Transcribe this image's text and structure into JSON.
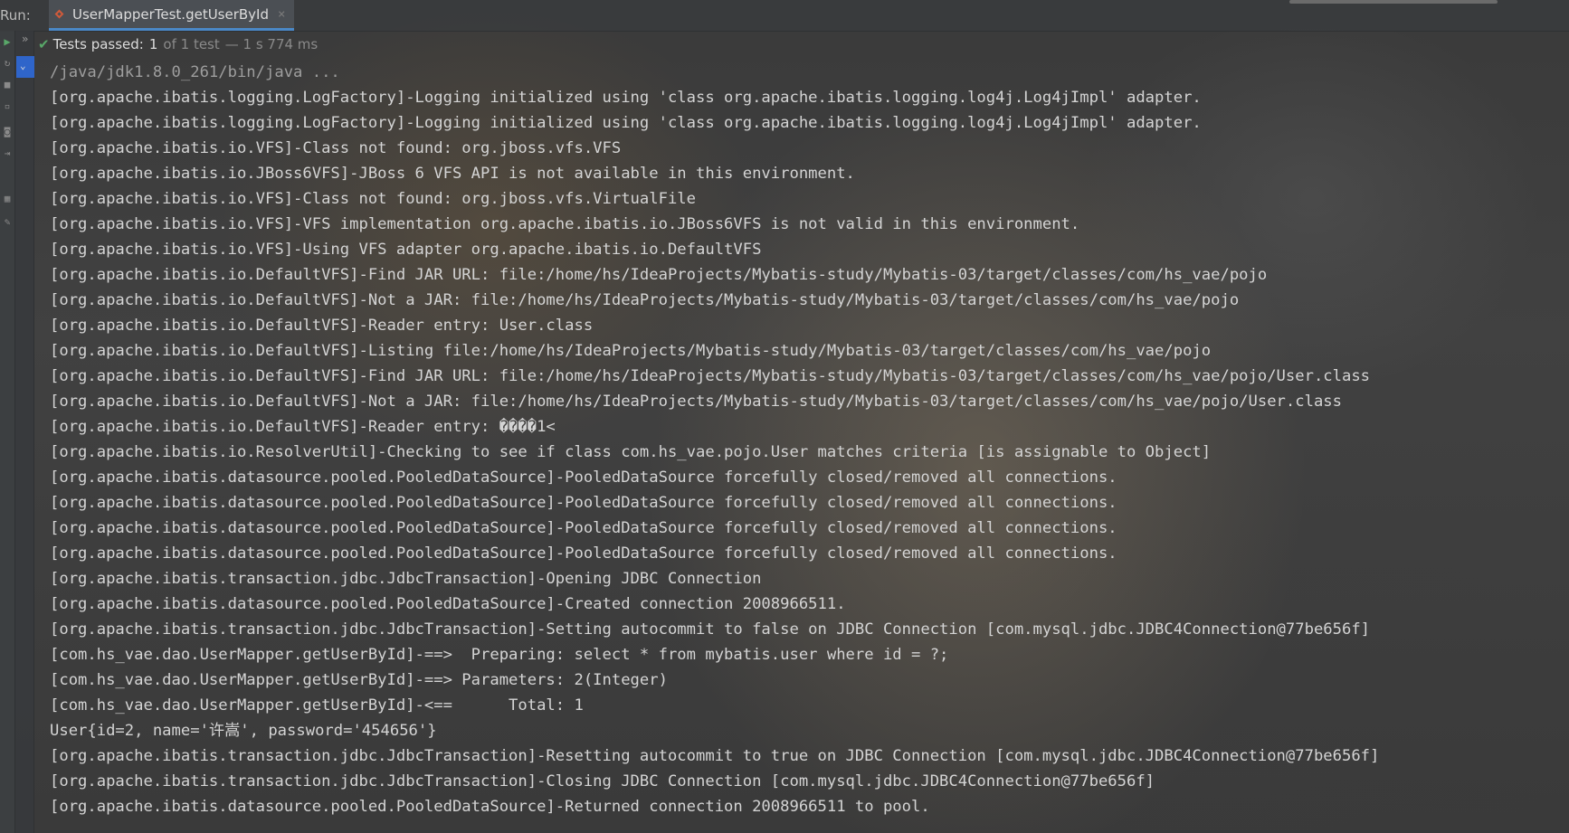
{
  "run_bar": {
    "label": "Run:",
    "tab_title": "UserMapperTest.getUserById",
    "tab_close": "×"
  },
  "status": {
    "label": "Tests passed:",
    "count": "1",
    "of_text": "of 1 test",
    "time": "— 1 s 774 ms"
  },
  "console": {
    "lines": [
      "/java/jdk1.8.0_261/bin/java ...",
      "[org.apache.ibatis.logging.LogFactory]-Logging initialized using 'class org.apache.ibatis.logging.log4j.Log4jImpl' adapter.",
      "[org.apache.ibatis.logging.LogFactory]-Logging initialized using 'class org.apache.ibatis.logging.log4j.Log4jImpl' adapter.",
      "[org.apache.ibatis.io.VFS]-Class not found: org.jboss.vfs.VFS",
      "[org.apache.ibatis.io.JBoss6VFS]-JBoss 6 VFS API is not available in this environment.",
      "[org.apache.ibatis.io.VFS]-Class not found: org.jboss.vfs.VirtualFile",
      "[org.apache.ibatis.io.VFS]-VFS implementation org.apache.ibatis.io.JBoss6VFS is not valid in this environment.",
      "[org.apache.ibatis.io.VFS]-Using VFS adapter org.apache.ibatis.io.DefaultVFS",
      "[org.apache.ibatis.io.DefaultVFS]-Find JAR URL: file:/home/hs/IdeaProjects/Mybatis-study/Mybatis-03/target/classes/com/hs_vae/pojo",
      "[org.apache.ibatis.io.DefaultVFS]-Not a JAR: file:/home/hs/IdeaProjects/Mybatis-study/Mybatis-03/target/classes/com/hs_vae/pojo",
      "[org.apache.ibatis.io.DefaultVFS]-Reader entry: User.class",
      "[org.apache.ibatis.io.DefaultVFS]-Listing file:/home/hs/IdeaProjects/Mybatis-study/Mybatis-03/target/classes/com/hs_vae/pojo",
      "[org.apache.ibatis.io.DefaultVFS]-Find JAR URL: file:/home/hs/IdeaProjects/Mybatis-study/Mybatis-03/target/classes/com/hs_vae/pojo/User.class",
      "[org.apache.ibatis.io.DefaultVFS]-Not a JAR: file:/home/hs/IdeaProjects/Mybatis-study/Mybatis-03/target/classes/com/hs_vae/pojo/User.class",
      "[org.apache.ibatis.io.DefaultVFS]-Reader entry: ����1<",
      "[org.apache.ibatis.io.ResolverUtil]-Checking to see if class com.hs_vae.pojo.User matches criteria [is assignable to Object]",
      "[org.apache.ibatis.datasource.pooled.PooledDataSource]-PooledDataSource forcefully closed/removed all connections.",
      "[org.apache.ibatis.datasource.pooled.PooledDataSource]-PooledDataSource forcefully closed/removed all connections.",
      "[org.apache.ibatis.datasource.pooled.PooledDataSource]-PooledDataSource forcefully closed/removed all connections.",
      "[org.apache.ibatis.datasource.pooled.PooledDataSource]-PooledDataSource forcefully closed/removed all connections.",
      "[org.apache.ibatis.transaction.jdbc.JdbcTransaction]-Opening JDBC Connection",
      "[org.apache.ibatis.datasource.pooled.PooledDataSource]-Created connection 2008966511.",
      "[org.apache.ibatis.transaction.jdbc.JdbcTransaction]-Setting autocommit to false on JDBC Connection [com.mysql.jdbc.JDBC4Connection@77be656f]",
      "[com.hs_vae.dao.UserMapper.getUserById]-==>  Preparing: select * from mybatis.user where id = ?;",
      "[com.hs_vae.dao.UserMapper.getUserById]-==> Parameters: 2(Integer)",
      "[com.hs_vae.dao.UserMapper.getUserById]-<==      Total: 1",
      "User{id=2, name='许嵩', password='454656'}",
      "[org.apache.ibatis.transaction.jdbc.JdbcTransaction]-Resetting autocommit to true on JDBC Connection [com.mysql.jdbc.JDBC4Connection@77be656f]",
      "[org.apache.ibatis.transaction.jdbc.JdbcTransaction]-Closing JDBC Connection [com.mysql.jdbc.JDBC4Connection@77be656f]",
      "[org.apache.ibatis.datasource.pooled.PooledDataSource]-Returned connection 2008966511 to pool."
    ]
  },
  "colors": {
    "pass_green": "#59a869",
    "accent_blue": "#2f65ca",
    "text": "#d4d4d4"
  },
  "icons": [
    "play-icon",
    "rerun-icon",
    "stop-icon",
    "box-icon",
    "camera-icon",
    "import-icon",
    "layout-icon",
    "pin-icon",
    "check-icon",
    "chevron-down-icon",
    "expand-icon",
    "test-class-icon",
    "close-icon"
  ]
}
